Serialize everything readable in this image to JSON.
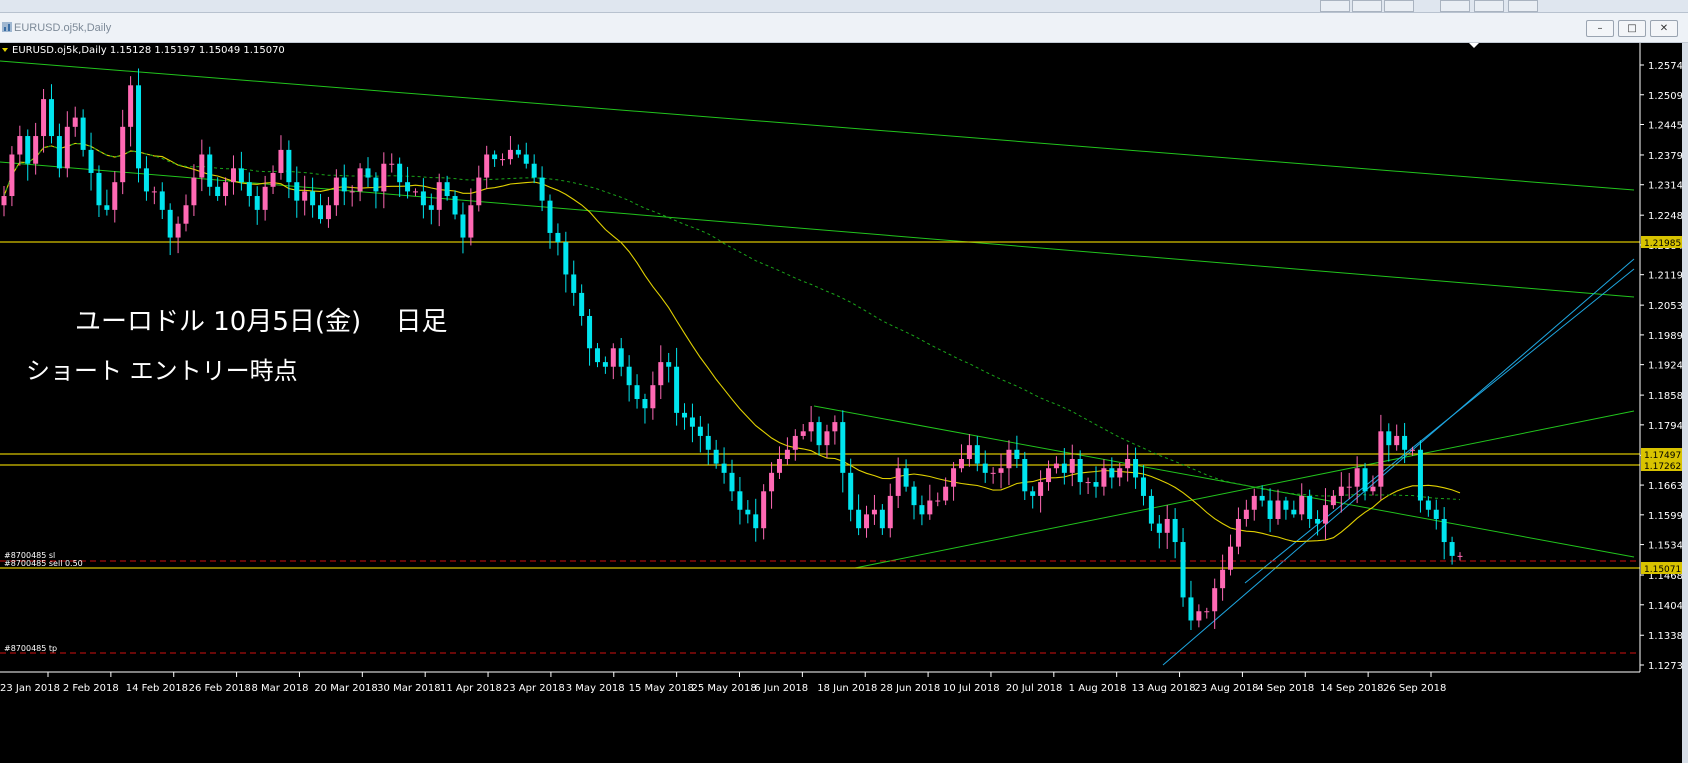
{
  "window": {
    "title": "EURUSD.oj5k,Daily",
    "buttons": [
      "minimize",
      "restore",
      "close"
    ]
  },
  "chart_header": "EURUSD.oj5k,Daily  1.15128 1.15197 1.15049 1.15070",
  "annotations": {
    "line1": "ユーロドル 10月5日(金)　 日足",
    "line2": "ショート エントリー時点"
  },
  "order_labels": {
    "sl": "#8700485 sl",
    "sell": "#8700485 sell 0.50",
    "tp": "#8700485 tp"
  },
  "price_axis": [
    "1.25740",
    "1.25095",
    "1.24450",
    "1.23790",
    "1.23145",
    "1.22485",
    "1.21840",
    "1.21195",
    "1.20535",
    "1.19890",
    "1.19245",
    "1.18585",
    "1.17940",
    "1.17280",
    "1.16635",
    "1.15990",
    "1.15345",
    "1.14685",
    "1.14040",
    "1.13380",
    "1.12735"
  ],
  "highlighted_prices": {
    "h1": "1.21985",
    "h2": "1.17497",
    "h3": "1.17262",
    "current": "1.15071"
  },
  "date_axis": [
    "23 Jan 2018",
    "2 Feb 2018",
    "14 Feb 2018",
    "26 Feb 2018",
    "8 Mar 2018",
    "20 Mar 2018",
    "30 Mar 2018",
    "11 Apr 2018",
    "23 Apr 2018",
    "3 May 2018",
    "15 May 2018",
    "25 May 2018",
    "6 Jun 2018",
    "18 Jun 2018",
    "28 Jun 2018",
    "10 Jul 2018",
    "20 Jul 2018",
    "1 Aug 2018",
    "13 Aug 2018",
    "23 Aug 2018",
    "4 Sep 2018",
    "14 Sep 2018",
    "26 Sep 2018"
  ],
  "colors": {
    "background": "#000000",
    "bull_candle": "#ff69b4",
    "bear_candle": "#00e5ee",
    "trendline": "#22c41d",
    "horizontal_level": "#d8c300",
    "order_line": "#d01010",
    "channel_line": "#1ea6e0",
    "ma_fast": "#e0d000",
    "ma_slow": "#1aa51a"
  },
  "chart_data": {
    "type": "candlestick",
    "symbol": "EURUSD.oj5k",
    "timeframe": "Daily",
    "last_ohlc": {
      "open": 1.15128,
      "high": 1.15197,
      "low": 1.15049,
      "close": 1.1507
    },
    "ylim": [
      1.1245,
      1.26
    ],
    "x_start": "2018-01-23",
    "x_end": "2018-10-05",
    "closes_approx": [
      1.229,
      1.238,
      1.242,
      1.236,
      1.242,
      1.25,
      1.242,
      1.235,
      1.244,
      1.246,
      1.239,
      1.234,
      1.227,
      1.226,
      1.232,
      1.244,
      1.253,
      1.235,
      1.23,
      1.23,
      1.226,
      1.22,
      1.223,
      1.227,
      1.233,
      1.238,
      1.231,
      1.229,
      1.232,
      1.235,
      1.232,
      1.229,
      1.226,
      1.231,
      1.234,
      1.239,
      1.232,
      1.228,
      1.23,
      1.227,
      1.224,
      1.227,
      1.233,
      1.23,
      1.23,
      1.235,
      1.233,
      1.23,
      1.236,
      1.236,
      1.232,
      1.23,
      1.23,
      1.227,
      1.226,
      1.232,
      1.229,
      1.225,
      1.22,
      1.227,
      1.233,
      1.238,
      1.237,
      1.237,
      1.239,
      1.238,
      1.236,
      1.233,
      1.228,
      1.221,
      1.219,
      1.212,
      1.208,
      1.203,
      1.196,
      1.193,
      1.192,
      1.196,
      1.192,
      1.188,
      1.185,
      1.183,
      1.188,
      1.193,
      1.192,
      1.182,
      1.181,
      1.179,
      1.177,
      1.174,
      1.171,
      1.169,
      1.165,
      1.161,
      1.16,
      1.157,
      1.165,
      1.169,
      1.172,
      1.174,
      1.177,
      1.178,
      1.18,
      1.175,
      1.178,
      1.18,
      1.169,
      1.161,
      1.157,
      1.16,
      1.161,
      1.157,
      1.164,
      1.17,
      1.166,
      1.162,
      1.16,
      1.163,
      1.163,
      1.166,
      1.17,
      1.172,
      1.175,
      1.171,
      1.169,
      1.169,
      1.17,
      1.174,
      1.172,
      1.165,
      1.164,
      1.167,
      1.17,
      1.171,
      1.169,
      1.172,
      1.167,
      1.167,
      1.166,
      1.17,
      1.168,
      1.17,
      1.172,
      1.168,
      1.164,
      1.158,
      1.156,
      1.159,
      1.154,
      1.142,
      1.137,
      1.139,
      1.139,
      1.144,
      1.148,
      1.153,
      1.159,
      1.161,
      1.164,
      1.163,
      1.159,
      1.163,
      1.161,
      1.16,
      1.164,
      1.159,
      1.158,
      1.162,
      1.164,
      1.166,
      1.166,
      1.17,
      1.165,
      1.166,
      1.178,
      1.175,
      1.177,
      1.174,
      1.174,
      1.163,
      1.161,
      1.159,
      1.154,
      1.151,
      1.151
    ]
  }
}
